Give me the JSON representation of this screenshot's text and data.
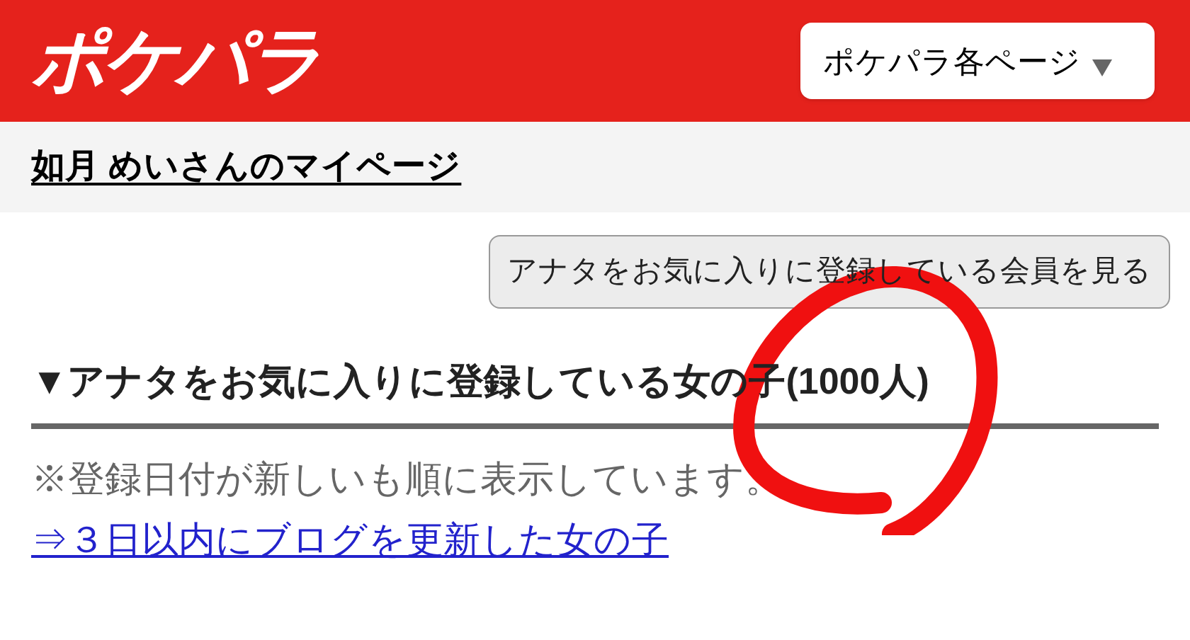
{
  "header": {
    "logo": "ポケパラ",
    "menu_button": "ポケパラ各ページ"
  },
  "page_title": "如月 めいさんのマイページ",
  "action_button": "アナタをお気に入りに登録している会員を見る",
  "section": {
    "heading": "▼アナタをお気に入りに登録している女の子(1000人)",
    "note": "※登録日付が新しいも順に表示しています。",
    "link": "⇒３日以内にブログを更新した女の子"
  }
}
